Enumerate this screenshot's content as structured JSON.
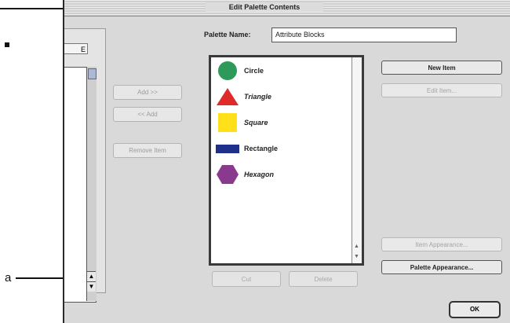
{
  "dialog": {
    "title": "Edit Palette Contents"
  },
  "left_pane": {
    "popup_label": "E"
  },
  "middle_buttons": {
    "add": "Add >>",
    "remove_arrow": "<< Add",
    "remove_item": "Remove Item"
  },
  "palette_name": {
    "label": "Palette Name:",
    "value": "Attribute Blocks"
  },
  "items": [
    {
      "label": "Circle",
      "shape": "circle",
      "color": "#2e9a5a"
    },
    {
      "label": "Triangle",
      "shape": "triangle",
      "color": "#e02a2a"
    },
    {
      "label": "Square",
      "shape": "square",
      "color": "#ffe01a"
    },
    {
      "label": "Rectangle",
      "shape": "rectangle",
      "color": "#1f2f8a"
    },
    {
      "label": "Hexagon",
      "shape": "hexagon",
      "color": "#8a3a8e"
    }
  ],
  "right_buttons": {
    "new_item": "New Item",
    "edit_item": "Edit Item...",
    "item_appearance": "Item Appearance...",
    "palette_appearance": "Palette Appearance..."
  },
  "bottom_buttons": {
    "cut": "Cut",
    "delete": "Delete"
  },
  "ok": "OK",
  "annotation": {
    "label": "a"
  }
}
